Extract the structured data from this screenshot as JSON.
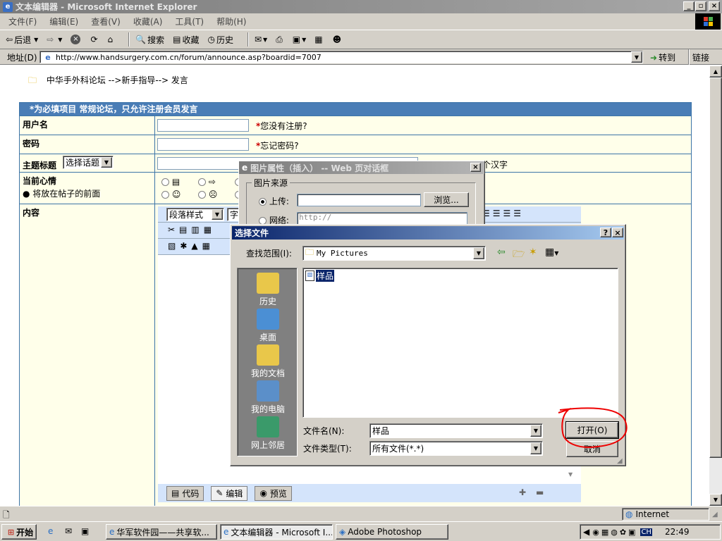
{
  "window": {
    "title": "文本编辑器 - Microsoft Internet Explorer",
    "menu": [
      "文件(F)",
      "编辑(E)",
      "查看(V)",
      "收藏(A)",
      "工具(T)",
      "帮助(H)"
    ]
  },
  "toolbar": {
    "back": "后退",
    "search": "搜索",
    "favorites": "收藏",
    "history": "历史"
  },
  "address": {
    "label": "地址(D)",
    "url": "http://www.handsurgery.com.cn/forum/announce.asp?boardid=7007",
    "go": "转到",
    "links": "链接"
  },
  "page": {
    "breadcrumb": "中华手外科论坛 -->新手指导--> 发言",
    "form_header": "*为必填项目 常规论坛，只允许注册会员发言",
    "username_label": "用户名",
    "username_hint": "您没有注册?",
    "password_label": "密码",
    "password_hint": "忘记密码?",
    "subject_label": "主题标题",
    "topic_select": "选择话题",
    "subject_hint": "个汉字",
    "mood_label": "当前心情",
    "mood_hint": "将放在帖子的前面",
    "content_label": "内容",
    "para_style": "段落样式",
    "font_label": "字",
    "tabs": [
      "代码",
      "编辑",
      "预览"
    ]
  },
  "image_dialog": {
    "title": "图片属性（插入） -- Web 页对话框",
    "source_group": "图片来源",
    "upload_label": "上传:",
    "browse_button": "浏览...",
    "network_label": "网络:",
    "network_value": "http://"
  },
  "file_dialog": {
    "title": "选择文件",
    "look_in_label": "查找范围(I):",
    "look_in_value": "My Pictures",
    "places": [
      "历史",
      "桌面",
      "我的文档",
      "我的电脑",
      "网上邻居"
    ],
    "files": [
      "样品"
    ],
    "filename_label": "文件名(N):",
    "filename_value": "样品",
    "filetype_label": "文件类型(T):",
    "filetype_value": "所有文件(*.*)",
    "open_button": "打开(O)",
    "cancel_button": "取消"
  },
  "statusbar": {
    "zone": "Internet"
  },
  "taskbar": {
    "start": "开始",
    "tasks": [
      "华军软件园——共享软...",
      "文本编辑器 - Microsoft I...",
      "Adobe Photoshop"
    ],
    "lang": "CH",
    "clock": "22:49"
  },
  "colors": {
    "form_header": "#4a7db6",
    "form_border": "#3c74a8",
    "row_bg": "#ffffea",
    "dialog_title": "#0a246a",
    "annotation_red": "#ee0000"
  }
}
